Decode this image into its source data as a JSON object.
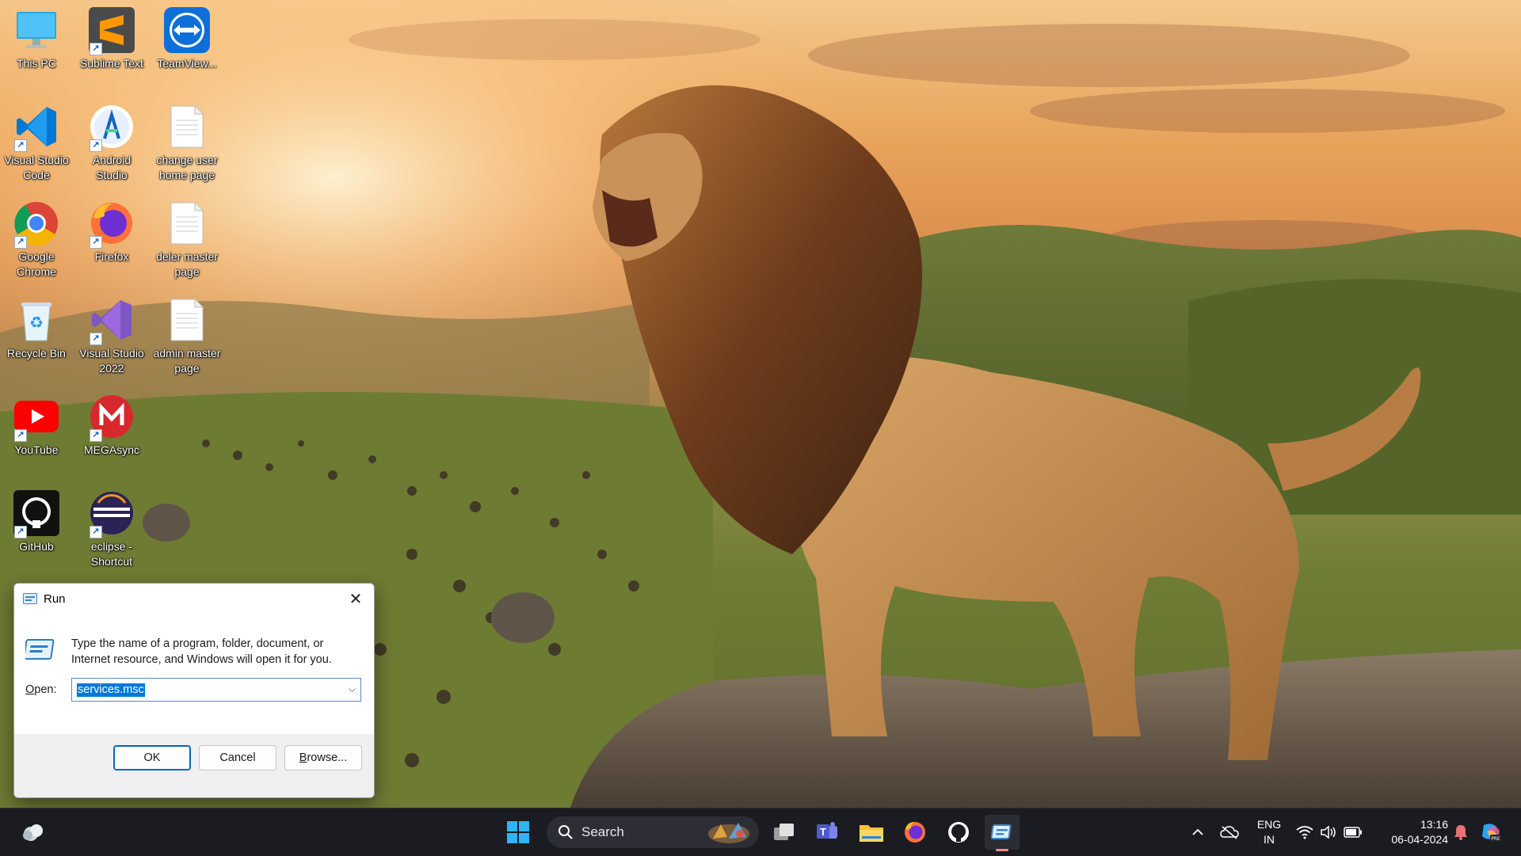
{
  "desktop": {
    "icons": [
      {
        "label": "This PC",
        "icon": "monitor-icon",
        "shortcut": false
      },
      {
        "label": "Sublime Text",
        "icon": "sublime-text-icon",
        "shortcut": true
      },
      {
        "label": "TeamView...",
        "icon": "teamviewer-icon",
        "shortcut": false
      },
      {
        "label": "Visual Studio Code",
        "icon": "vscode-icon",
        "shortcut": true
      },
      {
        "label": "Android Studio",
        "icon": "android-studio-icon",
        "shortcut": true
      },
      {
        "label": "change user home page",
        "icon": "document-icon",
        "shortcut": false
      },
      {
        "label": "Google Chrome",
        "icon": "chrome-icon",
        "shortcut": true
      },
      {
        "label": "Firefox",
        "icon": "firefox-icon",
        "shortcut": true
      },
      {
        "label": "deler master page",
        "icon": "document-icon",
        "shortcut": false
      },
      {
        "label": "Recycle Bin",
        "icon": "recycle-bin-icon",
        "shortcut": false
      },
      {
        "label": "Visual Studio 2022",
        "icon": "visual-studio-icon",
        "shortcut": true
      },
      {
        "label": "admin master page",
        "icon": "document-icon",
        "shortcut": false
      },
      {
        "label": "YouTube",
        "icon": "youtube-icon",
        "shortcut": true
      },
      {
        "label": "MEGAsync",
        "icon": "megasync-icon",
        "shortcut": true
      },
      {
        "label": "GitHub",
        "icon": "github-icon",
        "shortcut": true
      },
      {
        "label": "eclipse - Shortcut",
        "icon": "eclipse-icon",
        "shortcut": true
      }
    ]
  },
  "run_dialog": {
    "title": "Run",
    "description": "Type the name of a program, folder, document, or Internet resource, and Windows will open it for you.",
    "open_label_accel": "O",
    "open_label_rest": "pen:",
    "input_value": "services.msc",
    "ok_label": "OK",
    "cancel_label": "Cancel",
    "browse_label_accel": "B",
    "browse_label_rest": "rowse..."
  },
  "taskbar": {
    "search_placeholder": "Search",
    "apps": [
      "widgets-icon",
      "start-icon",
      "task-view-icon",
      "teams-icon",
      "file-explorer-icon",
      "firefox-icon",
      "github-icon",
      "run-icon"
    ],
    "active_app": "run-icon",
    "language_line1": "ENG",
    "language_line2": "IN",
    "time": "13:16",
    "date": "06-04-2024",
    "accent": "#f28b82"
  }
}
